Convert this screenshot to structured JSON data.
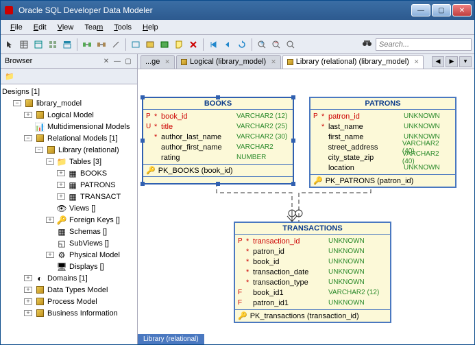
{
  "window": {
    "title": "Oracle SQL Developer Data Modeler"
  },
  "menu": {
    "file": "File",
    "edit": "Edit",
    "view": "View",
    "team": "Team",
    "tools": "Tools",
    "help": "Help"
  },
  "search": {
    "placeholder": "Search..."
  },
  "sidebar": {
    "title": "Browser",
    "tree": {
      "designs": "Designs [1]",
      "library_model": "library_model",
      "logical_model": "Logical Model",
      "multidimensional": "Multidimensional Models",
      "relational_models": "Relational Models [1]",
      "library_relational": "Library (relational)",
      "tables": "Tables [3]",
      "books": "BOOKS",
      "patrons": "PATRONS",
      "transact": "TRANSACT",
      "views": "Views []",
      "foreign_keys": "Foreign Keys []",
      "schemas": "Schemas []",
      "subviews": "SubViews []",
      "physical_model": "Physical Model",
      "displays": "Displays []",
      "domains": "Domains [1]",
      "data_types": "Data Types Model",
      "process_model": "Process Model",
      "business_info": "Business Information"
    }
  },
  "tabs": {
    "t0": "...ge",
    "t1": "Logical (library_model)",
    "t2": "Library (relational) (library_model)"
  },
  "entities": {
    "books": {
      "title": "BOOKS",
      "pk": "PK_BOOKS (book_id)",
      "cols": [
        {
          "flag": "P",
          "star": "*",
          "name": "book_id",
          "type": "VARCHAR2 (12)",
          "black": false
        },
        {
          "flag": "U",
          "star": "*",
          "name": "title",
          "type": "VARCHAR2 (25)",
          "black": false
        },
        {
          "flag": "",
          "star": "*",
          "name": "author_last_name",
          "type": "VARCHAR2 (30)",
          "black": true
        },
        {
          "flag": "",
          "star": "",
          "name": "author_first_name",
          "type": "VARCHAR2",
          "black": true
        },
        {
          "flag": "",
          "star": "",
          "name": "rating",
          "type": "NUMBER",
          "black": true
        }
      ]
    },
    "patrons": {
      "title": "PATRONS",
      "pk": "PK_PATRONS (patron_id)",
      "cols": [
        {
          "flag": "P",
          "star": "*",
          "name": "patron_id",
          "type": "UNKNOWN",
          "black": false
        },
        {
          "flag": "",
          "star": "*",
          "name": "last_name",
          "type": "UNKNOWN",
          "black": true
        },
        {
          "flag": "",
          "star": "",
          "name": "first_name",
          "type": "UNKNOWN",
          "black": true
        },
        {
          "flag": "",
          "star": "",
          "name": "street_address",
          "type": "VARCHAR2 (40)",
          "black": true
        },
        {
          "flag": "",
          "star": "",
          "name": "city_state_zip",
          "type": "VARCHAR2 (40)",
          "black": true
        },
        {
          "flag": "",
          "star": "",
          "name": "location",
          "type": "UNKNOWN",
          "black": true
        }
      ]
    },
    "transactions": {
      "title": "TRANSACTIONS",
      "pk": "PK_transactions (transaction_id)",
      "cols": [
        {
          "flag": "P",
          "star": "*",
          "name": "transaction_id",
          "type": "UNKNOWN",
          "black": false
        },
        {
          "flag": "",
          "star": "*",
          "name": "patron_id",
          "type": "UNKNOWN",
          "black": true
        },
        {
          "flag": "",
          "star": "*",
          "name": "book_id",
          "type": "UNKNOWN",
          "black": true
        },
        {
          "flag": "",
          "star": "*",
          "name": "transaction_date",
          "type": "UNKNOWN",
          "black": true
        },
        {
          "flag": "",
          "star": "*",
          "name": "transaction_type",
          "type": "UNKNOWN",
          "black": true
        },
        {
          "flag": "F",
          "star": "",
          "name": "book_id1",
          "type": "VARCHAR2 (12)",
          "black": true
        },
        {
          "flag": "F",
          "star": "",
          "name": "patron_id1",
          "type": "UNKNOWN",
          "black": true
        }
      ]
    }
  },
  "footer_tab": "Library (relational)"
}
